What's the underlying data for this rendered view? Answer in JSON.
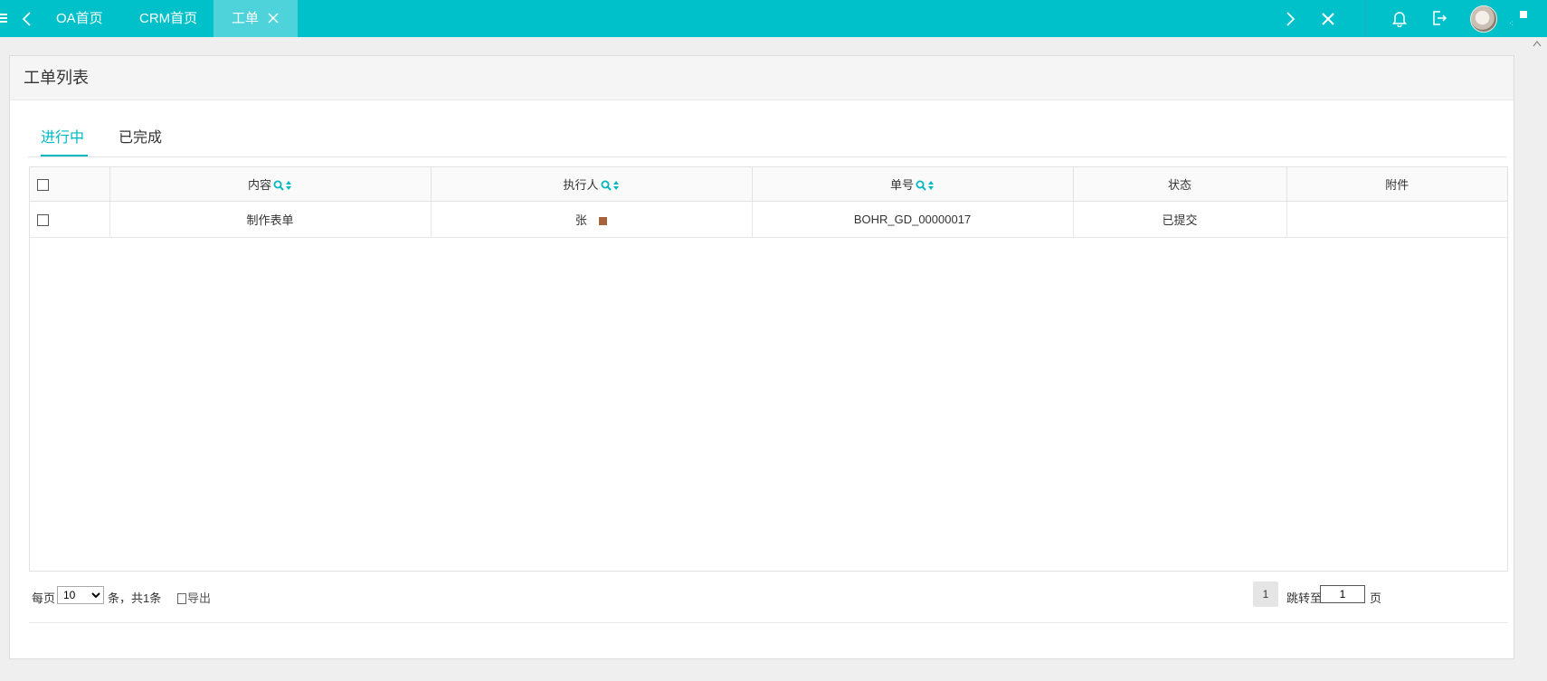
{
  "topbar": {
    "tabs": [
      {
        "label": "OA首页"
      },
      {
        "label": "CRM首页"
      },
      {
        "label": "工单"
      }
    ],
    "accent_color": "#00c1c9",
    "icons": [
      "menu-icon",
      "chevron-left-icon",
      "close-icon",
      "chevron-right-icon",
      "close-all-icon",
      "bell-icon",
      "logout-icon"
    ]
  },
  "panel": {
    "title": "工单列表",
    "tabs": [
      {
        "label": "进行中"
      },
      {
        "label": "已完成"
      }
    ]
  },
  "table": {
    "columns": [
      {
        "label": "内容"
      },
      {
        "label": "执行人"
      },
      {
        "label": "单号"
      },
      {
        "label": "状态"
      },
      {
        "label": "附件"
      }
    ],
    "rows": [
      {
        "content": "制作表单",
        "executor": "张",
        "number": "BOHR_GD_00000017",
        "status": "已提交",
        "attachment": ""
      }
    ]
  },
  "footer": {
    "per_page_label": "每页",
    "per_page_value": "10",
    "total_label": "条，共1条",
    "export_label": "导出",
    "current_page": "1",
    "jump_label": "跳转至",
    "jump_value": "1",
    "page_unit": "页"
  }
}
